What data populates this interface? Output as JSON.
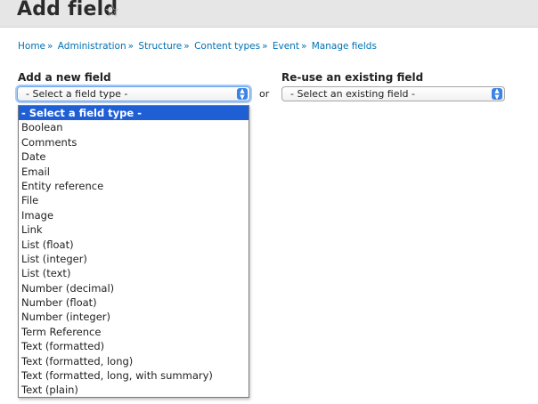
{
  "page": {
    "title": "Add field",
    "favorite_icon": "star-outline-icon"
  },
  "breadcrumb": [
    "Home",
    "Administration",
    "Structure",
    "Content types",
    "Event",
    "Manage fields"
  ],
  "breadcrumb_separator": "»",
  "new_field": {
    "label": "Add a new field",
    "select_value": "- Select a field type -",
    "options": [
      "- Select a field type -",
      "Boolean",
      "Comments",
      "Date",
      "Email",
      "Entity reference",
      "File",
      "Image",
      "Link",
      "List (float)",
      "List (integer)",
      "List (text)",
      "Number (decimal)",
      "Number (float)",
      "Number (integer)",
      "Term Reference",
      "Text (formatted)",
      "Text (formatted, long)",
      "Text (formatted, long, with summary)",
      "Text (plain)"
    ]
  },
  "or_text": "or",
  "existing_field": {
    "label": "Re-use an existing field",
    "select_value": "- Select an existing field -"
  },
  "colors": {
    "link": "#0071b3",
    "selected_option": "#1f5fd6",
    "select_arrow": "#3a83e6"
  }
}
